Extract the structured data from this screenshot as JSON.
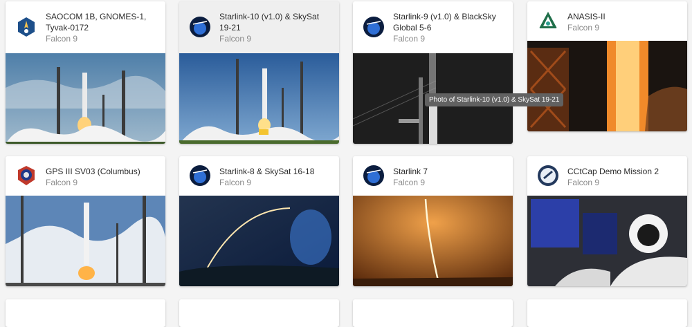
{
  "launches": [
    {
      "name": "SAOCOM 1B, GNOMES-1, Tyvak-0172",
      "rocket": "Falcon 9",
      "patch_color": "#1d4f8a"
    },
    {
      "name": "Starlink-10 (v1.0) & SkySat 19-21",
      "rocket": "Falcon 9",
      "patch_color": "#0b1d3f"
    },
    {
      "name": "Starlink-9 (v1.0) & BlackSky Global 5-6",
      "rocket": "Falcon 9",
      "patch_color": "#0b1d3f"
    },
    {
      "name": "ANASIS-II",
      "rocket": "Falcon 9",
      "patch_color": "#1f6f4a"
    },
    {
      "name": "GPS III SV03 (Columbus)",
      "rocket": "Falcon 9",
      "patch_color": "#c0392b"
    },
    {
      "name": "Starlink-8 & SkySat 16-18",
      "rocket": "Falcon 9",
      "patch_color": "#0b1d3f"
    },
    {
      "name": "Starlink 7",
      "rocket": "Falcon 9",
      "patch_color": "#0b1d3f"
    },
    {
      "name": "CCtCap Demo Mission 2",
      "rocket": "Falcon 9",
      "patch_color": "#23395d"
    }
  ],
  "tooltip": "Photo of Starlink-10 (v1.0) & SkySat 19-21"
}
